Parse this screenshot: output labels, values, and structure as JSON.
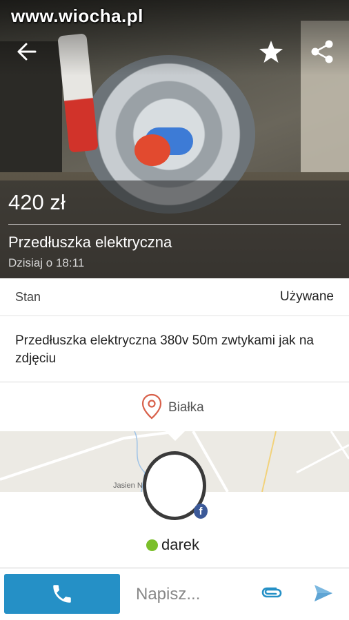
{
  "watermark": "www.wiocha.pl",
  "header": {
    "back_icon": "arrow-back-icon",
    "favorite_icon": "star-icon",
    "share_icon": "share-icon"
  },
  "listing": {
    "price": "420 zł",
    "title": "Przedłuszka elektryczna",
    "date": "Dzisiaj o 18:11",
    "condition_label": "Stan",
    "condition_value": "Używane",
    "description": "Przedłuszka elektryczna 380v 50m zwtykami jak na zdjęciu",
    "location": "Białka",
    "map_label": "Jasien Nowy"
  },
  "seller": {
    "name": "darek",
    "online_color": "#7bbf2a"
  },
  "bottom_bar": {
    "message_placeholder": "Napisz...",
    "accent": "#2590c6"
  }
}
